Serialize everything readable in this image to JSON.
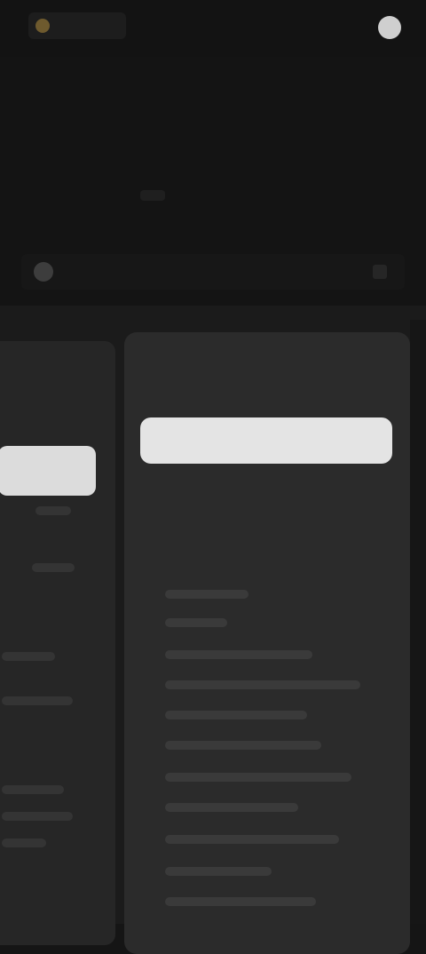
{
  "colors": {
    "background": "#151515",
    "card": "#2b2b2b",
    "primary_button": "#e4e4e4",
    "logo_accent": "#6e5a2e"
  },
  "icons": {
    "logo": "logo-icon",
    "avatar": "user-avatar-icon",
    "menu": "hamburger-menu-icon",
    "search": "search-icon"
  }
}
